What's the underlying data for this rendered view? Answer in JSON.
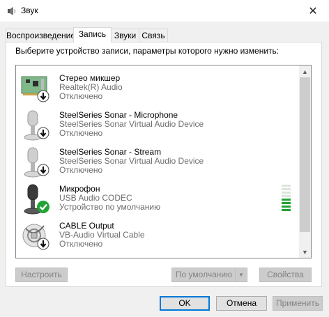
{
  "window": {
    "title": "Звук",
    "close_glyph": "✕"
  },
  "tabs": [
    {
      "label": "Воспроизведение",
      "active": false
    },
    {
      "label": "Запись",
      "active": true
    },
    {
      "label": "Звуки",
      "active": false
    },
    {
      "label": "Связь",
      "active": false
    }
  ],
  "instruction": "Выберите устройство записи, параметры которого нужно изменить:",
  "devices": [
    {
      "name": "Стерео микшер",
      "driver": "Realtek(R) Audio",
      "status": "Отключено",
      "icon": "sound-card-icon",
      "badge": "disabled-arrow-icon"
    },
    {
      "name": "SteelSeries Sonar - Microphone",
      "driver": "SteelSeries Sonar Virtual Audio Device",
      "status": "Отключено",
      "icon": "microphone-icon",
      "badge": "disabled-arrow-icon"
    },
    {
      "name": "SteelSeries Sonar - Stream",
      "driver": "SteelSeries Sonar Virtual Audio Device",
      "status": "Отключено",
      "icon": "microphone-icon",
      "badge": "disabled-arrow-icon"
    },
    {
      "name": "Микрофон",
      "driver": "USB Audio CODEC",
      "status": "Устройство по умолчанию",
      "icon": "microphone-icon",
      "badge": "default-check-icon",
      "level_fraction": 0.5
    },
    {
      "name": "CABLE Output",
      "driver": "VB-Audio Virtual Cable",
      "status": "Отключено",
      "icon": "cable-icon",
      "badge": "disabled-arrow-icon"
    }
  ],
  "buttons": {
    "configure": "Настроить",
    "set_default": "По умолчанию",
    "properties": "Свойства",
    "ok": "OK",
    "cancel": "Отмена",
    "apply": "Применить"
  },
  "colors": {
    "accent": "#0078d7",
    "level_on": "#21a336",
    "check_badge": "#21a336"
  }
}
